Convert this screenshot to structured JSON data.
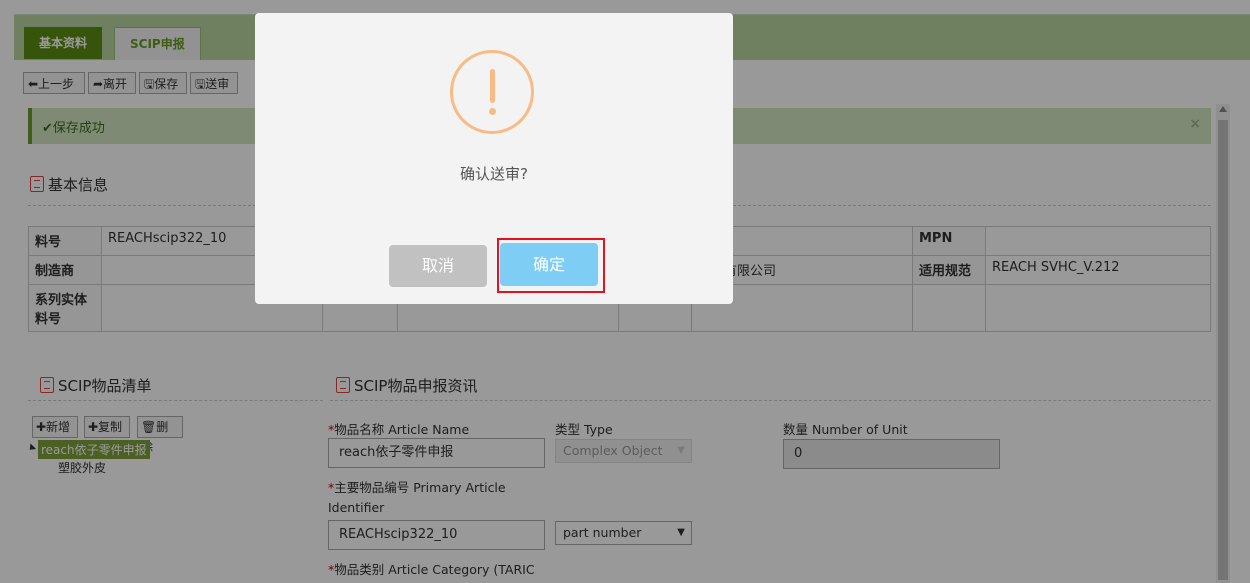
{
  "tabs": [
    {
      "label": "基本资料"
    },
    {
      "label": "SCIP申报"
    }
  ],
  "toolbar": {
    "prev": "⬅上一步",
    "leave": "➦离开",
    "save": "🖫保存",
    "submit": "🖫送审"
  },
  "alert": {
    "message": "✔保存成功",
    "close": "×"
  },
  "basic_info": {
    "title": "基本信息",
    "rows": [
      {
        "label": "料号",
        "value": "REACHscip322_10"
      },
      {
        "label": "制造商",
        "value": ""
      },
      {
        "label": "系列实体料号",
        "value": ""
      }
    ],
    "col3_rows": [
      {
        "label": "",
        "value": ""
      },
      {
        "label": "",
        "value": "电子有限公司"
      },
      {
        "label": "",
        "value": ""
      }
    ],
    "col4_rows": [
      {
        "label": "MPN",
        "value": ""
      },
      {
        "label": "适用规范",
        "value": "REACH SVHC_V.212"
      },
      {
        "label": "",
        "value": ""
      }
    ]
  },
  "scip_list": {
    "title": "SCIP物品清单",
    "buttons": {
      "add": "✚新增",
      "copy": "✚复制",
      "delete": "🗑删除"
    },
    "tree_selected": "reach依子零件申报",
    "tree_child": "塑胶外皮"
  },
  "scip_form": {
    "title": "SCIP物品申报资讯",
    "article_name_label": "物品名称 Article Name",
    "article_name_value": "reach依子零件申报",
    "type_label": "类型 Type",
    "type_value": "Complex Object",
    "units_label": "数量 Number of Unit",
    "units_value": "0",
    "primary_id_label_1": "主要物品编号 Primary Article",
    "primary_id_label_2": "Identifier",
    "primary_id_value": "REACHscip322_10",
    "id_type_value": "part number",
    "category_label": "物品类别 Article Category (TARIC",
    "required_mark": "*"
  },
  "dialog": {
    "message": "确认送审?",
    "cancel": "取消",
    "confirm": "确定"
  },
  "colors": {
    "tab_active": "#5a8c12",
    "dialog_warning": "#f8bb86",
    "confirm_button": "#7ecdf4",
    "highlight_box": "#e0141e"
  }
}
